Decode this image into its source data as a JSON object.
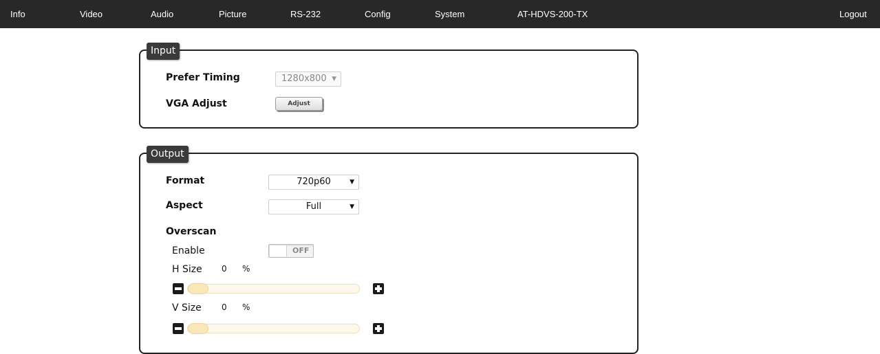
{
  "nav": {
    "items": [
      "Info",
      "Video",
      "Audio",
      "Picture",
      "RS-232",
      "Config",
      "System",
      "AT-HDVS-200-TX"
    ],
    "logout": "Logout"
  },
  "input": {
    "legend": "Input",
    "prefer_timing_label": "Prefer Timing",
    "prefer_timing_value": "1280x800",
    "vga_adjust_label": "VGA Adjust",
    "adjust_button": "Adjust"
  },
  "output": {
    "legend": "Output",
    "format_label": "Format",
    "format_value": "720p60",
    "aspect_label": "Aspect",
    "aspect_value": "Full",
    "overscan_label": "Overscan",
    "enable_label": "Enable",
    "enable_state": "OFF",
    "hsize_label": "H Size",
    "hsize_value": "0",
    "hsize_unit": "%",
    "hsize_level": 0,
    "vsize_label": "V Size",
    "vsize_value": "0",
    "vsize_unit": "%",
    "vsize_level": 0
  },
  "icons": {
    "dropdown": "chevron-down-icon",
    "minus": "minus-icon",
    "plus": "plus-icon"
  },
  "colors": {
    "nav_bg": "#282828",
    "legend_bg": "#3a3a3a",
    "slider_fill": "#f3e1b3"
  }
}
